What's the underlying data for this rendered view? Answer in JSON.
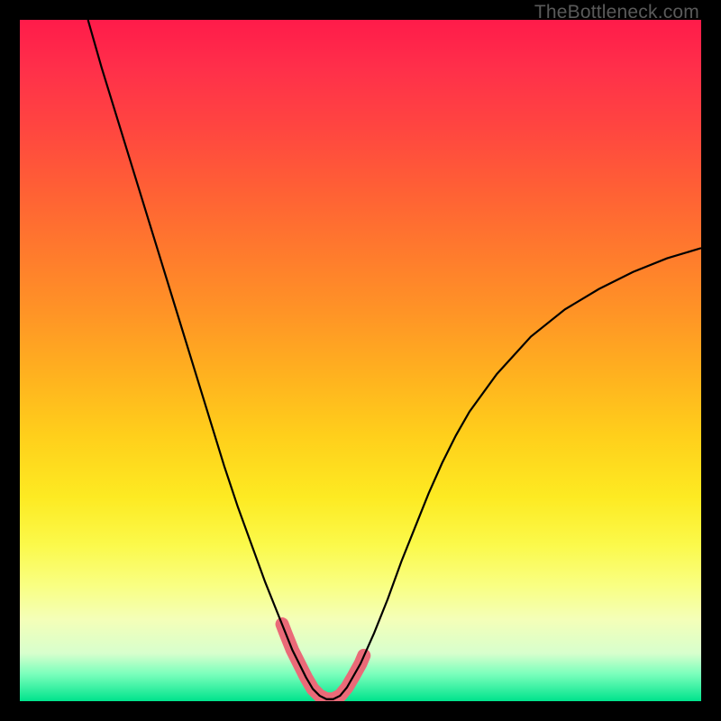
{
  "watermark": "TheBottleneck.com",
  "chart_data": {
    "type": "line",
    "title": "",
    "xlabel": "",
    "ylabel": "",
    "xlim": [
      0,
      100
    ],
    "ylim": [
      0,
      100
    ],
    "grid": false,
    "legend": false,
    "series": [
      {
        "name": "bottleneck-curve",
        "x": [
          10,
          12,
          14,
          16,
          18,
          20,
          22,
          24,
          26,
          28,
          30,
          32,
          34,
          36,
          38,
          39,
          40,
          41,
          42,
          43,
          44,
          45,
          46,
          47,
          48,
          50,
          52,
          54,
          56,
          58,
          60,
          62,
          64,
          66,
          70,
          75,
          80,
          85,
          90,
          95,
          100
        ],
        "values": [
          100,
          93,
          86.5,
          80,
          73.5,
          67,
          60.5,
          54,
          47.5,
          41,
          34.5,
          28.5,
          23,
          17.5,
          12.5,
          10,
          7.5,
          5.5,
          3.5,
          1.8,
          0.8,
          0.3,
          0.3,
          0.8,
          2,
          5.5,
          10,
          15,
          20.5,
          25.5,
          30.5,
          35,
          39,
          42.5,
          48,
          53.5,
          57.5,
          60.5,
          63,
          65,
          66.5
        ]
      },
      {
        "name": "highlight-segment",
        "x": [
          38.5,
          39,
          40,
          41,
          42,
          43,
          44,
          45,
          46,
          47,
          48,
          49,
          50,
          50.5
        ],
        "values": [
          11.3,
          10,
          7.5,
          5.5,
          3.5,
          1.8,
          0.8,
          0.3,
          0.3,
          0.8,
          2,
          3.7,
          5.5,
          6.7
        ]
      }
    ],
    "background_gradient": {
      "top_color": "#ff1b4a",
      "bottom_color": "#00e38c"
    }
  }
}
